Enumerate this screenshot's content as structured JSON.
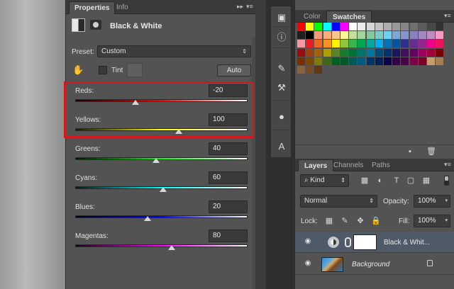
{
  "properties_panel": {
    "tabs": [
      "Properties",
      "Info"
    ],
    "title": "Black & White",
    "preset_label": "Preset:",
    "preset_value": "Custom",
    "tint_label": "Tint",
    "auto_label": "Auto",
    "sliders": [
      {
        "label": "Reds:",
        "value": "-20",
        "level_percent": 35,
        "gradient": [
          "#1a0000",
          "#ff0000",
          "#ffffff"
        ]
      },
      {
        "label": "Yellows:",
        "value": "100",
        "level_percent": 60,
        "gradient": [
          "#1a1a00",
          "#ffff00",
          "#ffffff"
        ]
      },
      {
        "label": "Greens:",
        "value": "40",
        "level_percent": 47,
        "gradient": [
          "#001a00",
          "#00ff00",
          "#ffffff"
        ]
      },
      {
        "label": "Cyans:",
        "value": "60",
        "level_percent": 51,
        "gradient": [
          "#001a1a",
          "#00ffff",
          "#ffffff"
        ]
      },
      {
        "label": "Blues:",
        "value": "20",
        "level_percent": 42,
        "gradient": [
          "#00001a",
          "#0000ff",
          "#ffffff"
        ]
      },
      {
        "label": "Magentas:",
        "value": "80",
        "level_percent": 56,
        "gradient": [
          "#1a001a",
          "#ff00ff",
          "#ffffff"
        ]
      }
    ]
  },
  "tool_strip": {
    "icons": [
      "layer-comps-icon",
      "info-icon",
      "brushes-icon",
      "tool-presets-icon",
      "kuler-icon",
      "character-icon"
    ]
  },
  "color_panel": {
    "tabs": [
      "Color",
      "Swatches"
    ]
  },
  "swatch_rows": [
    [
      "#ff0000",
      "#ffff00",
      "#00ff00",
      "#00ffff",
      "#0000ff",
      "#ff00ff",
      "#ffffff",
      "#ebebeb",
      "#d6d6d6",
      "#c2c2c2",
      "#adadad",
      "#999999",
      "#858585",
      "#707070",
      "#5c5c5c",
      "#474747",
      "#333333"
    ],
    [
      "#1f1f1f",
      "#000000",
      "#f7977a",
      "#fbad82",
      "#fdc68c",
      "#fff79a",
      "#c4df9b",
      "#a3d39c",
      "#82ca9d",
      "#7bcdc8",
      "#6ecff6",
      "#7ea7d8",
      "#8493ca",
      "#8882be",
      "#a187be",
      "#bc8dbf",
      "#f49ac2"
    ],
    [
      "#f6989d",
      "#ed1c24",
      "#f26522",
      "#f7941d",
      "#fff200",
      "#8dc73f",
      "#39b54a",
      "#00a651",
      "#00a99d",
      "#00aeef",
      "#0072bc",
      "#0054a6",
      "#2e3192",
      "#662d91",
      "#92278f",
      "#ec008c",
      "#ed145b"
    ],
    [
      "#9e0b0f",
      "#a0410d",
      "#a36209",
      "#aba000",
      "#598527",
      "#1a7b30",
      "#007236",
      "#00746b",
      "#0076a3",
      "#004b80",
      "#003471",
      "#1b1464",
      "#440e62",
      "#630460",
      "#9e005d",
      "#9e0039",
      "#790000"
    ],
    [
      "#7b2e00",
      "#7d4900",
      "#827b00",
      "#406618",
      "#005e20",
      "#005826",
      "#005952",
      "#005b7f",
      "#003663",
      "#002157",
      "#0d004c",
      "#32004b",
      "#4b0049",
      "#7b0046",
      "#7a0026",
      "#c69c6e",
      "#a67c52"
    ],
    [
      "#8c6239",
      "#754c24",
      "#603813"
    ]
  ],
  "layers_panel": {
    "tabs": [
      "Layers",
      "Channels",
      "Paths"
    ],
    "kind_label": "Kind",
    "blend_mode": "Normal",
    "opacity_label": "Opacity:",
    "opacity_value": "100%",
    "lock_label": "Lock:",
    "fill_label": "Fill:",
    "fill_value": "100%",
    "layers": [
      {
        "name": "Black & Whit...",
        "selected": true
      },
      {
        "name": "Background",
        "selected": false
      }
    ]
  }
}
